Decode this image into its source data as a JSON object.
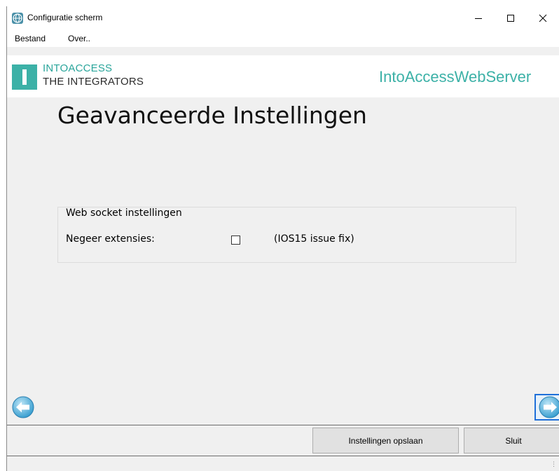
{
  "window": {
    "title": "Configuratie scherm",
    "icon": "globe-icon",
    "controls": [
      "minimize-icon",
      "maximize-icon",
      "close-icon"
    ]
  },
  "menu": {
    "items": [
      {
        "label": "Bestand"
      },
      {
        "label": "Over.."
      }
    ]
  },
  "header": {
    "logo_line1": "INTOACCESS",
    "logo_line2": "THE INTEGRATORS",
    "app_name": "IntoAccessWebServer",
    "brand_color": "#3cb1a7"
  },
  "page": {
    "title": "Geavanceerde Instellingen"
  },
  "websocket_group": {
    "legend": "Web socket instellingen",
    "ignore_extensions": {
      "label": "Negeer extensies:",
      "checked": false,
      "hint": "(IOS15 issue fix)"
    }
  },
  "navigation": {
    "back_icon": "arrow-left-circle-icon",
    "next_icon": "arrow-right-circle-icon"
  },
  "footer": {
    "save_label": "Instellingen opslaan",
    "close_label": "Sluit"
  }
}
